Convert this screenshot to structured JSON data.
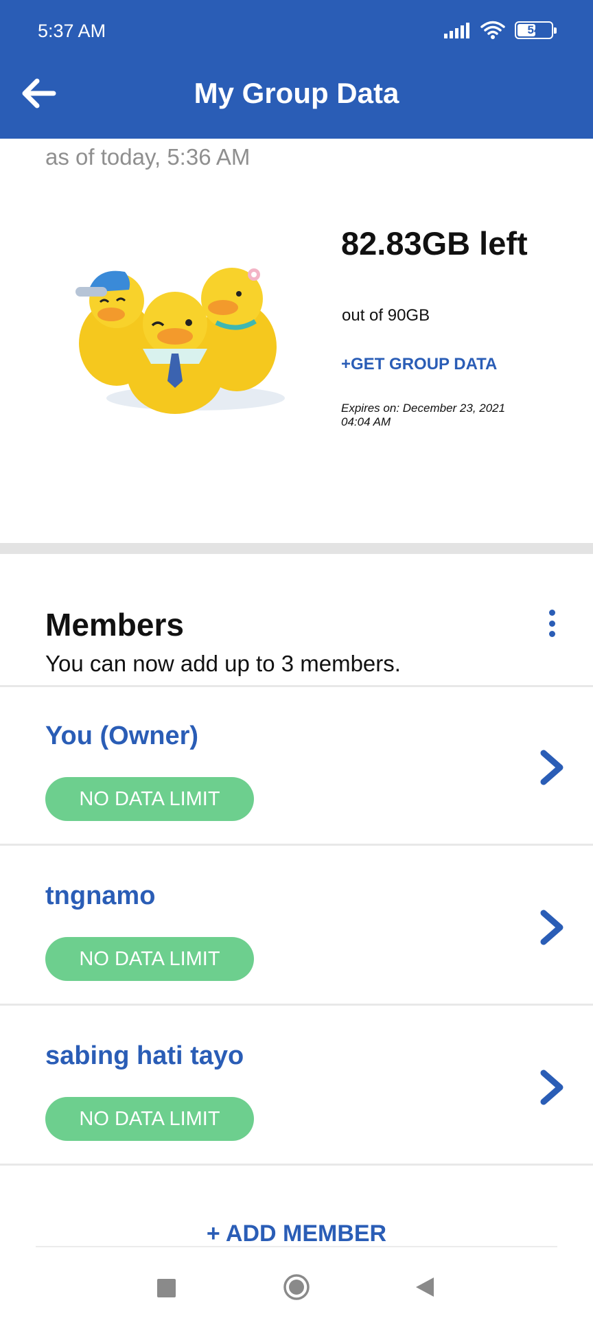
{
  "status_bar": {
    "time": "5:37 AM",
    "battery": "54",
    "battery_level": 0.54,
    "icons": [
      "signal-icon",
      "wifi-icon",
      "battery-icon"
    ]
  },
  "header": {
    "title": "My Group Data",
    "back_icon": "back-arrow-icon",
    "background_color": "#2a5db6"
  },
  "summary": {
    "as_of": "as of today, 5:36 AM",
    "data_left": "82.83GB left",
    "out_of": "out of 90GB",
    "get_group_data": "+GET GROUP DATA",
    "expires": "Expires on: December 23, 2021 04:04 AM"
  },
  "members": {
    "title": "Members",
    "subtitle": "You can now add up to 3 members.",
    "menu_icon": "kebab-menu-icon",
    "items": [
      {
        "name": "You (Owner)",
        "badge": "NO DATA LIMIT"
      },
      {
        "name": "tngnamo",
        "badge": "NO DATA LIMIT"
      },
      {
        "name": "sabing hati tayo",
        "badge": "NO DATA LIMIT"
      }
    ],
    "add_member": "+ ADD MEMBER",
    "badge_color": "#6dcf8e"
  },
  "nav_bar": {
    "icons": [
      "recent-apps-icon",
      "home-icon",
      "back-icon"
    ]
  }
}
